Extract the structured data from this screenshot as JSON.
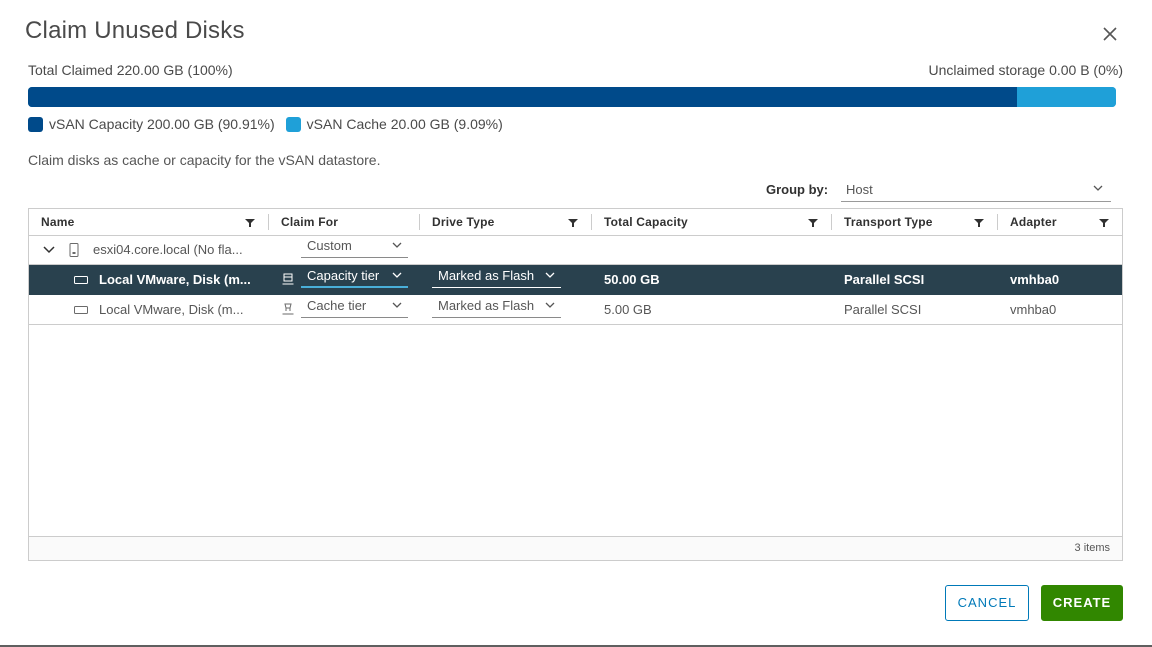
{
  "dialog": {
    "title": "Claim Unused Disks",
    "close_icon": "close-icon"
  },
  "summary": {
    "total_claimed": "Total Claimed 220.00 GB (100%)",
    "unclaimed": "Unclaimed storage 0.00 B (0%)",
    "capacity_fraction": 0.9091,
    "cache_fraction": 0.0909,
    "legend": [
      {
        "label": "vSAN Capacity 200.00 GB (90.91%)",
        "color": "#004a8a"
      },
      {
        "label": "vSAN Cache 20.00 GB (9.09%)",
        "color": "#1fa0d8"
      }
    ]
  },
  "description": "Claim disks as cache or capacity for the vSAN datastore.",
  "group_by": {
    "label": "Group by:",
    "value": "Host"
  },
  "grid": {
    "columns": [
      "Name",
      "Claim For",
      "Drive Type",
      "Total Capacity",
      "Transport Type",
      "Adapter"
    ],
    "host_row": {
      "name": "esxi04.core.local (No fla...",
      "claim_for": "Custom"
    },
    "disk_rows": [
      {
        "name": "Local VMware, Disk (m...",
        "claim_for": "Capacity tier",
        "drive_type": "Marked as Flash",
        "total_capacity": "50.00 GB",
        "transport_type": "Parallel SCSI",
        "adapter": "vmhba0",
        "selected": true
      },
      {
        "name": "Local VMware, Disk (m...",
        "claim_for": "Cache tier",
        "drive_type": "Marked as Flash",
        "total_capacity": "5.00 GB",
        "transport_type": "Parallel SCSI",
        "adapter": "vmhba0",
        "selected": false
      }
    ],
    "footer": "3 items"
  },
  "buttons": {
    "cancel": "CANCEL",
    "create": "CREATE"
  },
  "colors": {
    "capacity": "#004a8a",
    "cache": "#1fa0d8",
    "selected_row": "#29414e",
    "primary": "#0079b8",
    "success": "#318700"
  }
}
